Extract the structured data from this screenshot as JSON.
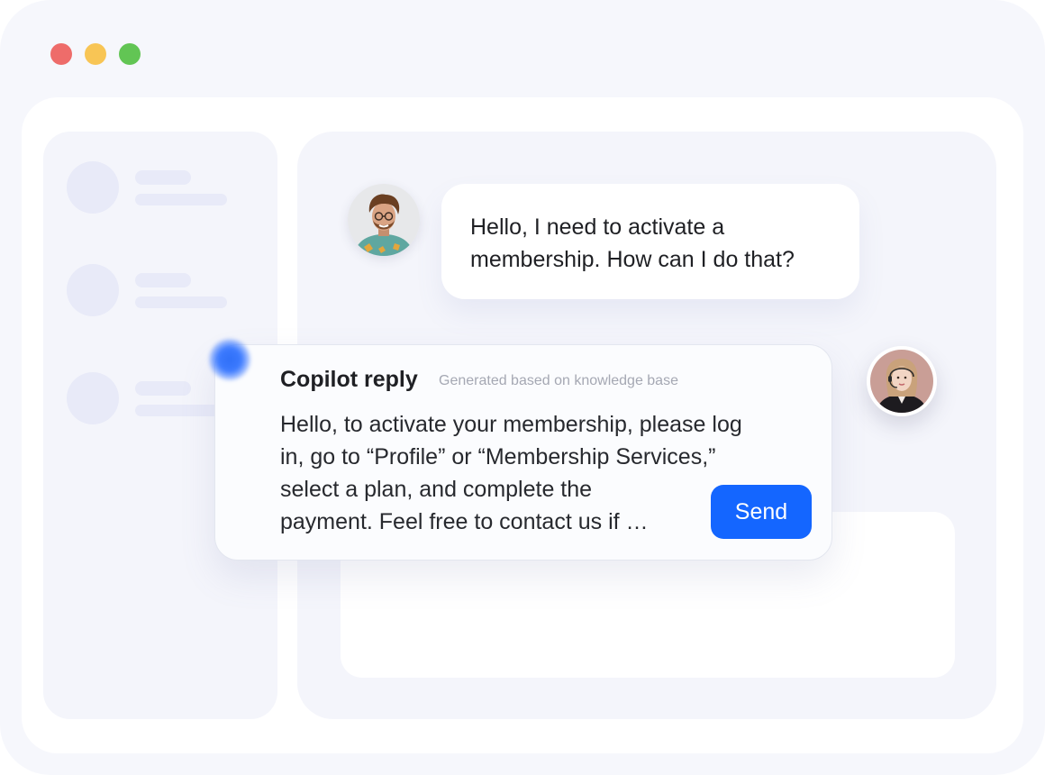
{
  "window": {
    "controls": [
      "close",
      "minimize",
      "maximize"
    ],
    "colors": {
      "close": "#ee6c6a",
      "minimize": "#f8c555",
      "maximize": "#62c554"
    }
  },
  "conversation": {
    "user_message": "Hello, I need to activate a membership. How can I do that?"
  },
  "copilot": {
    "title": "Copilot reply",
    "subtitle": "Generated based on knowledge base",
    "reply_lines": [
      "Hello, to activate your membership, please log",
      "in, go to “Profile” or “Membership Services,”",
      "select a plan, and complete the",
      "payment. Feel free to contact us if …"
    ],
    "send_label": "Send",
    "accent_color": "#1466ff"
  },
  "icons": {
    "user_avatar": "user-avatar",
    "agent_avatar": "agent-avatar",
    "copilot_indicator": "ai-glow-icon"
  }
}
